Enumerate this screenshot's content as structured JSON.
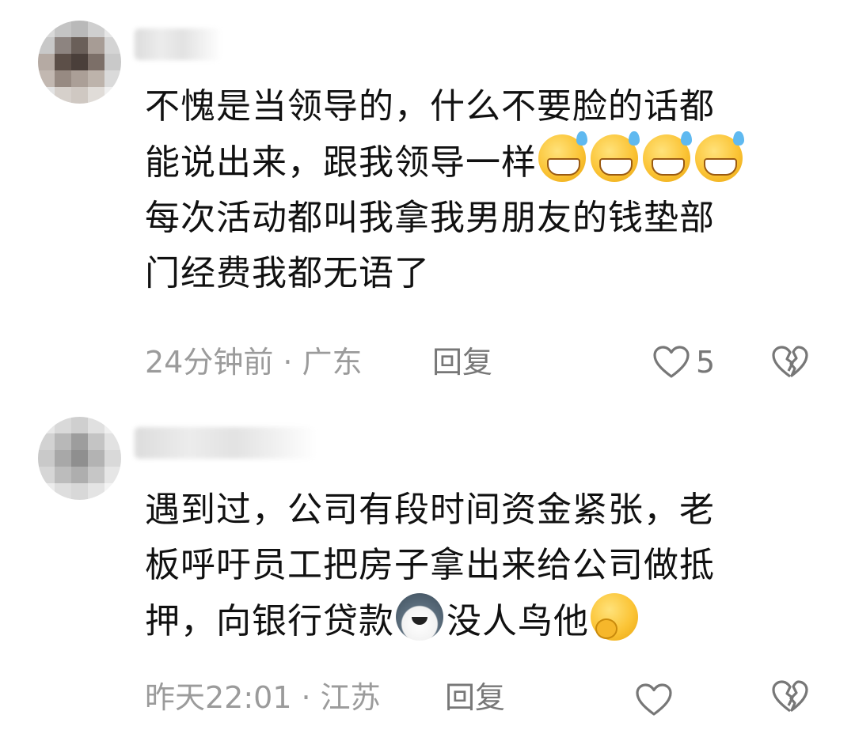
{
  "comments": [
    {
      "text_lines": [
        "不愧是当领导的，什么不要脸的话都",
        "能说出来，跟我领导一样",
        "每次活动都叫我拿我男朋友的钱垫部",
        "门经费我都无语了"
      ],
      "emoji": [
        "grinning-sweat-emoji",
        "grinning-sweat-emoji",
        "grinning-sweat-emoji",
        "grinning-sweat-emoji"
      ],
      "time": "24分钟前",
      "dot": "·",
      "location": "广东",
      "reply_label": "回复",
      "like_count": "5"
    },
    {
      "text_lines": [
        "遇到过，公司有段时间资金紧张，老",
        "板呼吁员工把房子拿出来给公司做抵",
        "押，向银行贷款",
        "没人鸟他"
      ],
      "emoji": [
        "husky-dog-emoji",
        "shy-face-emoji"
      ],
      "time": "昨天22:01",
      "dot": "·",
      "location": "江苏",
      "reply_label": "回复"
    }
  ],
  "colors": {
    "text": "#111111",
    "meta": "#9b9b9b",
    "icon": "#777777"
  }
}
